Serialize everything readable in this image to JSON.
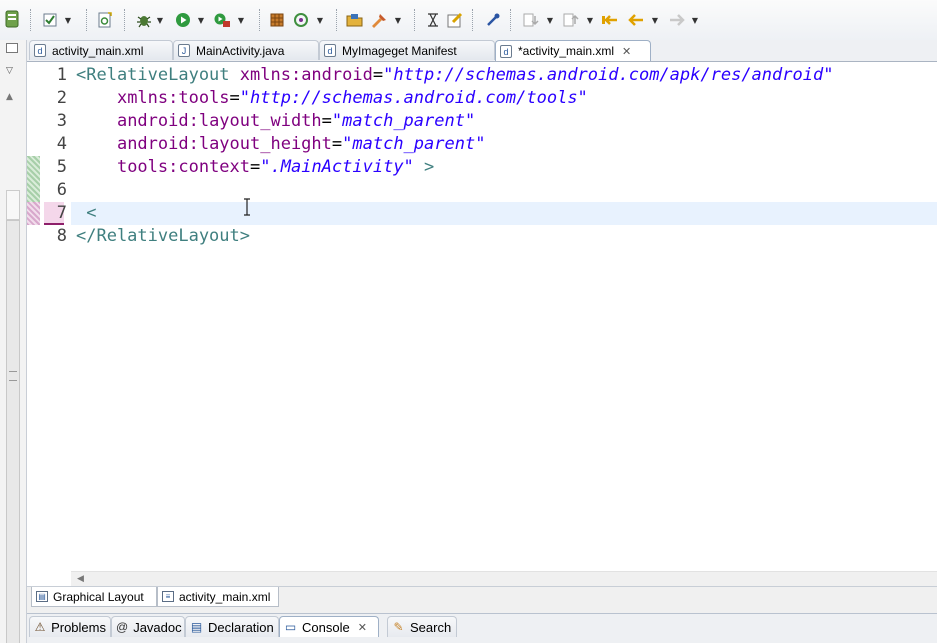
{
  "toolbar": {
    "icons": [
      "android-sdk-icon",
      "checkbox-toggle-icon",
      "new-android-class-icon",
      "debug-icon",
      "run-icon",
      "external-tools-icon",
      "open-type-icon",
      "refresh-icon",
      "open-folder-icon",
      "task-icon",
      "annotation-icon",
      "edit-icon",
      "pin-icon",
      "next-annotation-icon",
      "prev-annotation-icon",
      "last-edit-icon",
      "back-icon",
      "forward-icon"
    ]
  },
  "editor_tabs": [
    {
      "label": "activity_main.xml",
      "icon": "xml-file-icon",
      "active": false
    },
    {
      "label": "MainActivity.java",
      "icon": "java-file-icon",
      "active": false
    },
    {
      "label": "MyImageget Manifest",
      "icon": "manifest-file-icon",
      "active": false
    },
    {
      "label": "*activity_main.xml",
      "icon": "xml-file-icon",
      "active": true,
      "close": "✕"
    }
  ],
  "editor": {
    "line_numbers": [
      "1",
      "2",
      "3",
      "4",
      "5",
      "6",
      "7",
      "8"
    ],
    "current_line": "7",
    "lines": [
      {
        "tag_open": "<RelativeLayout",
        "attr": "xmlns:android",
        "eq": "=",
        "value": "\"http://schemas.android.com/apk/res/android\"",
        "indent": ""
      },
      {
        "attr": "xmlns:tools",
        "eq": "=",
        "value": "\"http://schemas.android.com/tools\"",
        "indent": "    "
      },
      {
        "attr": "android:layout_width",
        "eq": "=",
        "value": "\"match_parent\"",
        "indent": "    "
      },
      {
        "attr": "android:layout_height",
        "eq": "=",
        "value": "\"match_parent\"",
        "indent": "    "
      },
      {
        "attr": "tools:context",
        "eq": "=",
        "value": "\".MainActivity\"",
        "tag_close": " >",
        "indent": "    "
      },
      {
        "text": ""
      },
      {
        "tag_open": " <"
      },
      {
        "tag_open": "</RelativeLayout>"
      }
    ]
  },
  "editor_bottom_tabs": [
    {
      "label": "Graphical Layout",
      "icon": "graphical-layout-icon"
    },
    {
      "label": "activity_main.xml",
      "icon": "xml-source-icon"
    }
  ],
  "view_tabs": [
    {
      "label": "Problems",
      "icon": "problems-icon",
      "glyph": "⚠",
      "active": false
    },
    {
      "label": "Javadoc",
      "icon": "javadoc-icon",
      "glyph": "@",
      "active": false
    },
    {
      "label": "Declaration",
      "icon": "declaration-icon",
      "glyph": "▤",
      "active": false
    },
    {
      "label": "Console",
      "icon": "console-icon",
      "glyph": "▭",
      "active": true,
      "close": "✕"
    },
    {
      "label": "Search",
      "icon": "search-icon",
      "glyph": "✎",
      "active": false
    }
  ],
  "colors": {
    "tag": "#3f7f7f",
    "attribute": "#7f007f",
    "value": "#2a00ff",
    "current_line": "#e8f2fe",
    "change_marker": "#a7cfa9"
  }
}
